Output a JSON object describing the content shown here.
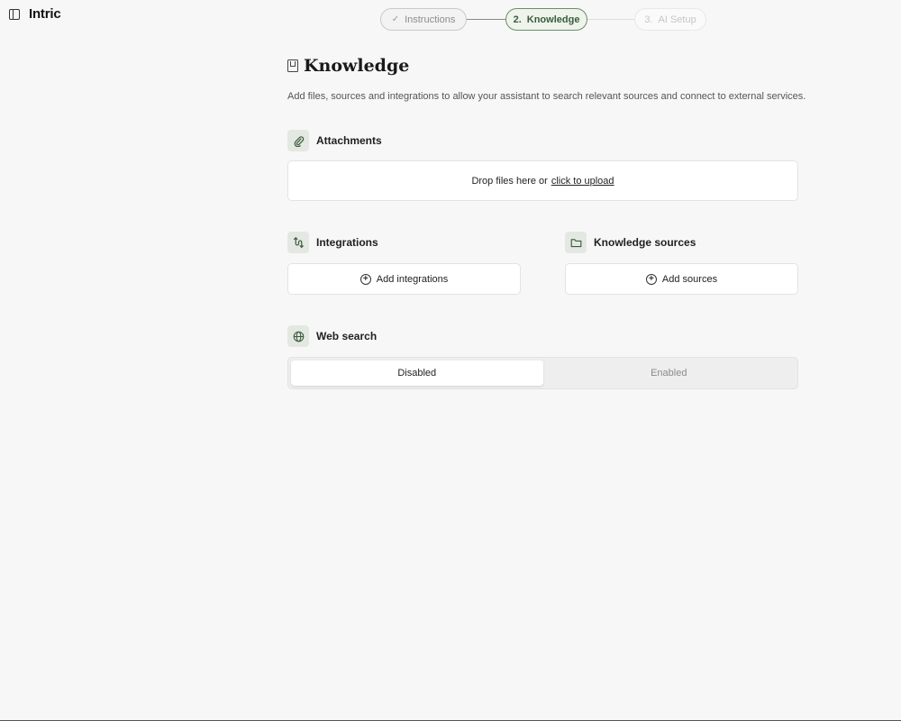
{
  "app": {
    "brand": "Intric"
  },
  "stepper": {
    "steps": [
      {
        "number": "",
        "label": "Instructions",
        "state": "completed"
      },
      {
        "number": "2.",
        "label": "Knowledge",
        "state": "active"
      },
      {
        "number": "3.",
        "label": "AI Setup",
        "state": "upcoming"
      }
    ]
  },
  "page": {
    "title": "Knowledge",
    "description": "Add files, sources and integrations to allow your assistant to search relevant sources and connect to external services."
  },
  "attachments": {
    "title": "Attachments",
    "drop_text": "Drop files here or",
    "upload_link": "click to upload"
  },
  "integrations": {
    "title": "Integrations",
    "button_label": "Add integrations"
  },
  "knowledge_sources": {
    "title": "Knowledge sources",
    "button_label": "Add sources"
  },
  "web_search": {
    "title": "Web search",
    "options": [
      {
        "label": "Disabled",
        "selected": true
      },
      {
        "label": "Enabled",
        "selected": false
      }
    ]
  },
  "colors": {
    "accent": "#6b8f6b",
    "icon_bg": "#e4e8e2",
    "background": "#f7f7f7"
  }
}
